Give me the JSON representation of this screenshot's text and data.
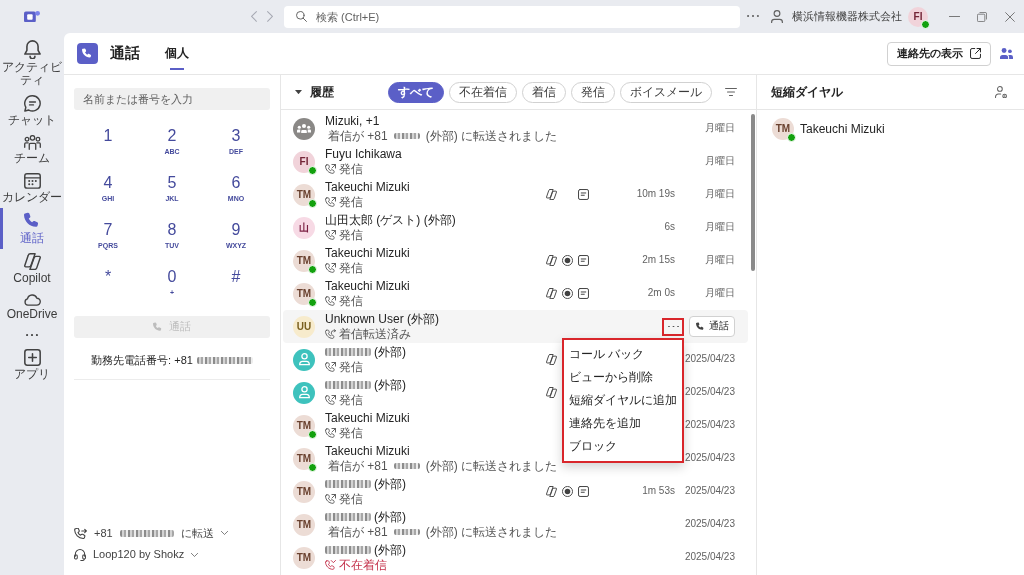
{
  "title_bar": {
    "search_placeholder": "検索 (Ctrl+E)",
    "organization": "横浜情報機器株式会社",
    "account": {
      "kind": "initials",
      "initials": "FI",
      "color": "#f1d3da",
      "online": true
    }
  },
  "rail": [
    {
      "kind": "bell",
      "label": "アクティビティ",
      "selected": false
    },
    {
      "kind": "chat",
      "label": "チャット",
      "selected": false
    },
    {
      "kind": "team",
      "label": "チーム",
      "selected": false
    },
    {
      "kind": "calendar",
      "label": "カレンダー",
      "selected": false
    },
    {
      "kind": "call",
      "label": "通話",
      "selected": true
    },
    {
      "kind": "copilot",
      "label": "Copilot",
      "selected": false
    },
    {
      "kind": "cloud",
      "label": "OneDrive",
      "selected": false
    },
    {
      "kind": "more",
      "selected": false
    },
    {
      "kind": "apps",
      "label": "アプリ",
      "selected": false
    }
  ],
  "header": {
    "title": "通話",
    "tabs": [
      {
        "label": "個人",
        "selected": true
      }
    ],
    "contacts_button": "連絡先の表示"
  },
  "dialer": {
    "placeholder": "名前または番号を入力",
    "keys": [
      {
        "digit": "1"
      },
      {
        "digit": "2",
        "letters": "ABC"
      },
      {
        "digit": "3",
        "letters": "DEF"
      },
      {
        "digit": "4",
        "letters": "GHI"
      },
      {
        "digit": "5",
        "letters": "JKL"
      },
      {
        "digit": "6",
        "letters": "MNO"
      },
      {
        "digit": "7",
        "letters": "PQRS"
      },
      {
        "digit": "8",
        "letters": "TUV"
      },
      {
        "digit": "9",
        "letters": "WXYZ"
      },
      {
        "digit": "*"
      },
      {
        "digit": "0",
        "letters": "+"
      },
      {
        "digit": "#"
      }
    ],
    "call_button": {
      "label": "通話",
      "disabled": true
    },
    "work_number": [
      {
        "kind": "text",
        "text": "勤務先電話番号: +81"
      },
      {
        "kind": "masked"
      }
    ],
    "forwarding": [
      {
        "kind": "text",
        "text": "+81"
      },
      {
        "kind": "masked"
      },
      {
        "kind": "text",
        "text": "に転送"
      }
    ],
    "audio_device": "Loop120 by Shokz"
  },
  "history": {
    "title": "履歴",
    "expanded": true,
    "filters": [
      {
        "label": "すべて",
        "selected": true
      },
      {
        "label": "不在着信",
        "selected": false
      },
      {
        "label": "着信",
        "selected": false
      },
      {
        "label": "発信",
        "selected": false
      },
      {
        "label": "ボイスメール",
        "selected": false
      }
    ],
    "rows": [
      {
        "avatar": {
          "kind": "group",
          "color": "#8a8886",
          "online": false
        },
        "name": "Mizuki, +1",
        "kind": "forwarded",
        "detail": [
          {
            "kind": "text",
            "text": "着信が +81"
          },
          {
            "kind": "masked"
          },
          {
            "kind": "text",
            "text": "(外部) に転送されました"
          }
        ],
        "date": "月曜日",
        "hovered": false
      },
      {
        "avatar": {
          "kind": "initials",
          "initials": "FI",
          "color": "#f1d3da",
          "online": true
        },
        "name": "Fuyu Ichikawa",
        "kind": "outgoing",
        "detail": "発信",
        "date": "月曜日",
        "hovered": false
      },
      {
        "avatar": {
          "kind": "initials",
          "initials": "TM",
          "color": "#ecdcd5",
          "online": true
        },
        "name": "Takeuchi Mizuki",
        "kind": "outgoing",
        "detail": "発信",
        "attachments": [
          {
            "kind": "copilot"
          },
          {
            "kind": "transcript"
          }
        ],
        "duration": "10m 19s",
        "date": "月曜日",
        "hovered": false
      },
      {
        "avatar": {
          "kind": "initials",
          "initials": "山",
          "color": "#f7dae5",
          "online": false
        },
        "name": "山田太郎 (ゲスト) (外部)",
        "kind": "outgoing",
        "detail": "発信",
        "duration": "6s",
        "date": "月曜日",
        "hovered": false
      },
      {
        "avatar": {
          "kind": "initials",
          "initials": "TM",
          "color": "#ecdcd5",
          "online": true
        },
        "name": "Takeuchi Mizuki",
        "kind": "outgoing",
        "detail": "発信",
        "attachments": [
          {
            "kind": "copilot"
          },
          {
            "kind": "recording"
          },
          {
            "kind": "transcript"
          }
        ],
        "duration": "2m 15s",
        "date": "月曜日",
        "hovered": false
      },
      {
        "avatar": {
          "kind": "initials",
          "initials": "TM",
          "color": "#ecdcd5",
          "online": true
        },
        "name": "Takeuchi Mizuki",
        "kind": "outgoing",
        "detail": "発信",
        "attachments": [
          {
            "kind": "copilot"
          },
          {
            "kind": "recording"
          },
          {
            "kind": "transcript"
          }
        ],
        "duration": "2m 0s",
        "date": "月曜日",
        "hovered": false
      },
      {
        "avatar": {
          "kind": "initials",
          "initials": "UU",
          "color": "#f7ebcc",
          "online": false
        },
        "name": "Unknown User (外部)",
        "kind": "forwarded",
        "detail": "着信転送済み",
        "hovered": true
      },
      {
        "avatar": {
          "kind": "person",
          "color": "#3ec2bd",
          "online": false
        },
        "name": [
          {
            "kind": "masked"
          },
          {
            "kind": "text",
            "text": "(外部)"
          }
        ],
        "kind": "outgoing",
        "detail": "発信",
        "attachments": [
          {
            "kind": "copilot"
          }
        ],
        "date": "2025/04/23",
        "hovered": false
      },
      {
        "avatar": {
          "kind": "person",
          "color": "#3ec2bd",
          "online": false
        },
        "name": [
          {
            "kind": "masked"
          },
          {
            "kind": "text",
            "text": "(外部)"
          }
        ],
        "kind": "outgoing",
        "detail": "発信",
        "attachments": [
          {
            "kind": "copilot"
          }
        ],
        "date": "2025/04/23",
        "hovered": false
      },
      {
        "avatar": {
          "kind": "initials",
          "initials": "TM",
          "color": "#ecdcd5",
          "online": true
        },
        "name": "Takeuchi Mizuki",
        "kind": "outgoing",
        "detail": "発信",
        "date": "2025/04/23",
        "hovered": false
      },
      {
        "avatar": {
          "kind": "initials",
          "initials": "TM",
          "color": "#ecdcd5",
          "online": true
        },
        "name": "Takeuchi Mizuki",
        "kind": "forwarded",
        "detail": [
          {
            "kind": "text",
            "text": "着信が +81"
          },
          {
            "kind": "masked"
          },
          {
            "kind": "text",
            "text": "(外部) に転送されました"
          }
        ],
        "date": "2025/04/23",
        "hovered": false
      },
      {
        "avatar": {
          "kind": "initials",
          "initials": "TM",
          "color": "#ecdcd5",
          "online": false
        },
        "name": [
          {
            "kind": "masked"
          },
          {
            "kind": "text",
            "text": "(外部)"
          }
        ],
        "kind": "outgoing",
        "detail": "発信",
        "attachments": [
          {
            "kind": "copilot"
          },
          {
            "kind": "recording"
          },
          {
            "kind": "transcript"
          }
        ],
        "duration": "1m 53s",
        "date": "2025/04/23",
        "hovered": false
      },
      {
        "avatar": {
          "kind": "initials",
          "initials": "TM",
          "color": "#ecdcd5",
          "online": false
        },
        "name": [
          {
            "kind": "masked"
          },
          {
            "kind": "text",
            "text": "(外部)"
          }
        ],
        "kind": "forwarded",
        "detail": [
          {
            "kind": "text",
            "text": "着信が +81"
          },
          {
            "kind": "masked"
          },
          {
            "kind": "text",
            "text": "(外部) に転送されました"
          }
        ],
        "date": "2025/04/23",
        "hovered": false
      },
      {
        "avatar": {
          "kind": "initials",
          "initials": "TM",
          "color": "#ecdcd5",
          "online": false
        },
        "name": [
          {
            "kind": "masked"
          },
          {
            "kind": "text",
            "text": "(外部)"
          }
        ],
        "kind": "missed",
        "detail": "不在着信",
        "date": "2025/04/23",
        "hovered": false
      }
    ],
    "hover_actions": {
      "call_button": "通話",
      "more_outlined": true
    },
    "context_menu": {
      "outlined": true,
      "items": [
        "コール バック",
        "ビューから削除",
        "短縮ダイヤルに追加",
        "連絡先を追加",
        "ブロック"
      ]
    }
  },
  "speed_dial": {
    "title": "短縮ダイヤル",
    "contacts": [
      {
        "avatar": {
          "kind": "initials",
          "initials": "TM",
          "color": "#ecdcd5",
          "online": true
        },
        "name": "Takeuchi Mizuki"
      }
    ]
  }
}
